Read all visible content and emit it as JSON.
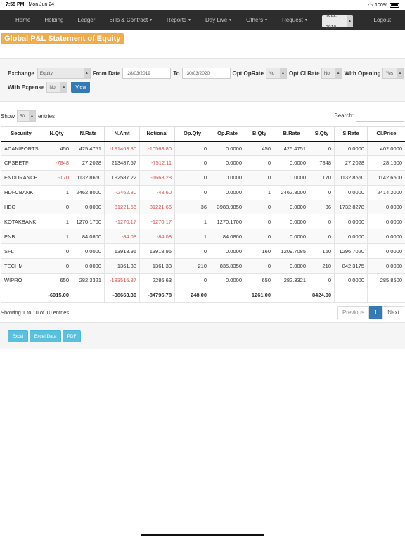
{
  "status_bar": {
    "time": "7:55 PM",
    "date": "Mon Jun 24",
    "battery": "100%"
  },
  "nav": {
    "items": [
      "Home",
      "Holding",
      "Ledger",
      "Bills & Contract",
      "Reports",
      "Day Live",
      "Others",
      "Request"
    ],
    "year": "Year: 2019",
    "logout": "Logout"
  },
  "page_title": "Global P&L Statement of Equity",
  "filters": {
    "exchange_label": "Exchange",
    "exchange_value": "Equity",
    "from_label": "From Date",
    "from_value": "28/03/2019",
    "to_label": "To",
    "to_value": "30/03/2020",
    "opt_oprate_label": "Opt OpRate",
    "opt_oprate_value": "No",
    "opt_clrate_label": "Opt Cl Rate",
    "opt_clrate_value": "No",
    "with_opening_label": "With Opening",
    "with_opening_value": "Yes",
    "with_expense_label": "With Expense",
    "with_expense_value": "No",
    "view_button": "View"
  },
  "table_controls": {
    "show_label": "Show",
    "entries_value": "50",
    "entries_label": "entries",
    "search_label": "Search:"
  },
  "table": {
    "columns": [
      "Security",
      "N.Qty",
      "N.Rate",
      "N.Amt",
      "Notional",
      "Op.Qty",
      "Op.Rate",
      "B.Qty",
      "B.Rate",
      "S.Qty",
      "S.Rate",
      "Cl.Price"
    ],
    "rows": [
      [
        "ADANIPORTS",
        "450",
        "425.4751",
        "-191463.80",
        "-10563.80",
        "0",
        "0.0000",
        "450",
        "425.4751",
        "0",
        "0.0000",
        "402.0000"
      ],
      [
        "CPSEETF",
        "-7848",
        "27.2028",
        "213487.57",
        "-7512.11",
        "0",
        "0.0000",
        "0",
        "0.0000",
        "7848",
        "27.2028",
        "28.1600"
      ],
      [
        "ENDURANCE",
        "-170",
        "1132.8660",
        "192587.22",
        "-1663.28",
        "0",
        "0.0000",
        "0",
        "0.0000",
        "170",
        "1132.8660",
        "1142.6500"
      ],
      [
        "HDFCBANK",
        "1",
        "2462.8000",
        "-2462.80",
        "-48.60",
        "0",
        "0.0000",
        "1",
        "2462.8000",
        "0",
        "0.0000",
        "2414.2000"
      ],
      [
        "HEG",
        "0",
        "0.0000",
        "-81221.66",
        "-81221.66",
        "36",
        "3988.9850",
        "0",
        "0.0000",
        "36",
        "1732.8278",
        "0.0000"
      ],
      [
        "KOTAKBANK",
        "1",
        "1270.1700",
        "-1270.17",
        "-1270.17",
        "1",
        "1270.1700",
        "0",
        "0.0000",
        "0",
        "0.0000",
        "0.0000"
      ],
      [
        "PNB",
        "1",
        "84.0800",
        "-84.08",
        "-84.08",
        "1",
        "84.0800",
        "0",
        "0.0000",
        "0",
        "0.0000",
        "0.0000"
      ],
      [
        "SFL",
        "0",
        "0.0000",
        "13918.96",
        "13918.96",
        "0",
        "0.0000",
        "160",
        "1209.7085",
        "160",
        "1296.7020",
        "0.0000"
      ],
      [
        "TECHM",
        "0",
        "0.0000",
        "1361.33",
        "1361.33",
        "210",
        "835.8350",
        "0",
        "0.0000",
        "210",
        "842.3175",
        "0.0000"
      ],
      [
        "WIPRO",
        "650",
        "282.3321",
        "-183515.87",
        "2286.63",
        "0",
        "0.0000",
        "650",
        "282.3321",
        "0",
        "0.0000",
        "285.8500"
      ]
    ],
    "totals": [
      "",
      "-6915.00",
      "",
      "-38663.30",
      "-84796.78",
      "248.00",
      "",
      "1261.00",
      "",
      "8424.00",
      "",
      ""
    ]
  },
  "footer": {
    "info": "Showing 1 to 10 of 10 entries",
    "previous": "Previous",
    "current_page": "1",
    "next": "Next"
  },
  "export": {
    "excel": "Excel",
    "excel_data": "Excel Data",
    "pdf": "PDF"
  },
  "colors": {
    "navbar": "#2d2d2d",
    "title_badge": "#f0ad4e",
    "primary": "#337ab7",
    "export_btn": "#5bc0de",
    "negative": "#d9534f"
  }
}
